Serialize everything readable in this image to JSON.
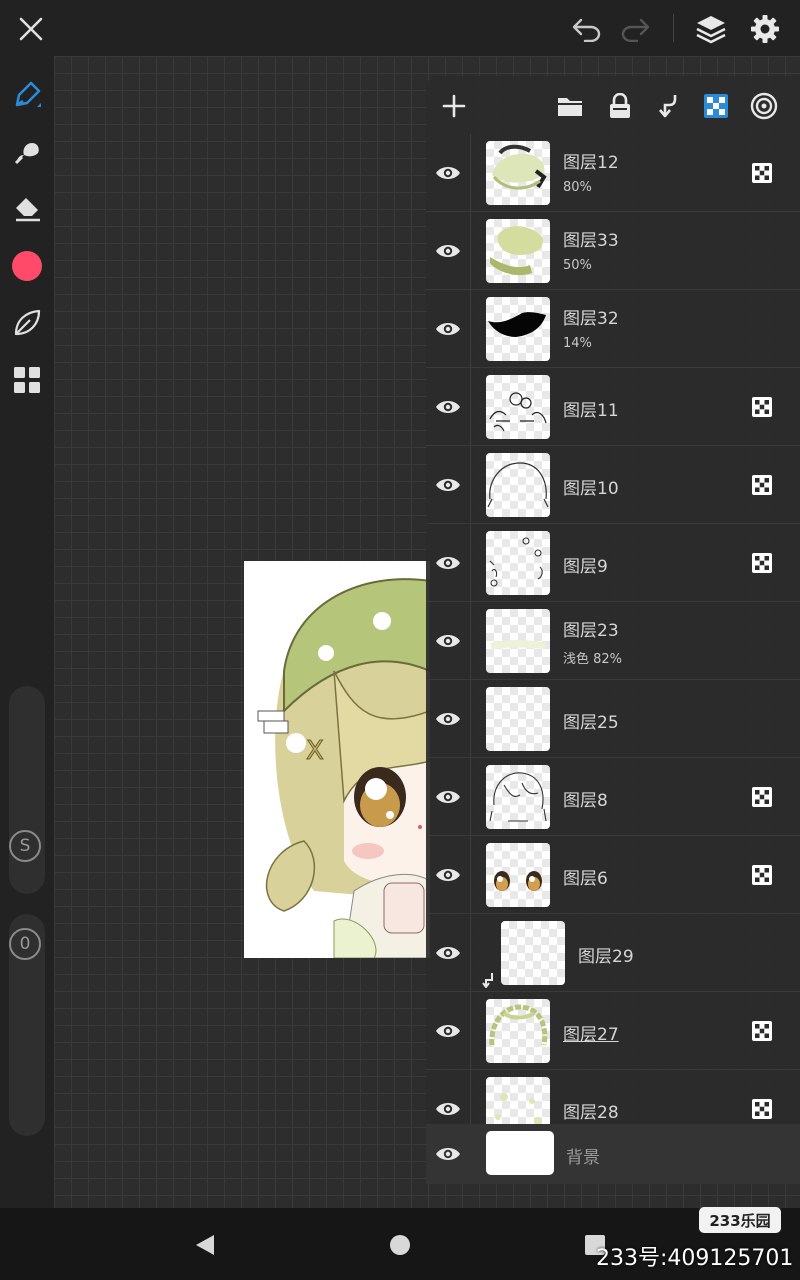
{
  "colors": {
    "accent_blue": "#2b8bd8",
    "brush_color": "#ff4a6a",
    "panel_bg": "#2b2b2b",
    "artwork_green": "#b5c57a"
  },
  "topbar": {
    "icons": [
      "close-icon",
      "undo-icon",
      "redo-icon",
      "layers-icon",
      "settings-icon"
    ]
  },
  "tools": [
    "brush-icon",
    "smudge-icon",
    "eraser-icon",
    "color-swatch",
    "leaf-icon",
    "grid-icon"
  ],
  "sliders": {
    "size_label": "S",
    "opacity_label": "0"
  },
  "layer_panel": {
    "header_icons": [
      "add-icon",
      "folder-icon",
      "lock-icon",
      "merge-down-icon",
      "alpha-lock-icon",
      "reference-icon"
    ],
    "layers": [
      {
        "name": "图层12",
        "sub": "80%",
        "alpha_lock": true
      },
      {
        "name": "图层33",
        "sub": "50%",
        "alpha_lock": false
      },
      {
        "name": "图层32",
        "sub": "14%",
        "alpha_lock": false
      },
      {
        "name": "图层11",
        "sub": "",
        "alpha_lock": true
      },
      {
        "name": "图层10",
        "sub": "",
        "alpha_lock": true
      },
      {
        "name": "图层9",
        "sub": "",
        "alpha_lock": true
      },
      {
        "name": "图层23",
        "sub": "浅色   82%",
        "alpha_lock": false
      },
      {
        "name": "图层25",
        "sub": "",
        "alpha_lock": false
      },
      {
        "name": "图层8",
        "sub": "",
        "alpha_lock": true
      },
      {
        "name": "图层6",
        "sub": "",
        "alpha_lock": true
      },
      {
        "name": "图层29",
        "sub": "",
        "alpha_lock": false,
        "clipped": true
      },
      {
        "name": "图层27",
        "sub": "",
        "alpha_lock": true,
        "selected": true
      },
      {
        "name": "图层28",
        "sub": "",
        "alpha_lock": true
      }
    ],
    "background": {
      "name": "背景"
    }
  },
  "navbar": {
    "icons": [
      "back-icon",
      "home-icon",
      "recents-icon"
    ]
  },
  "watermark": {
    "logo": "233乐园",
    "id_text": "233号:409125701"
  }
}
